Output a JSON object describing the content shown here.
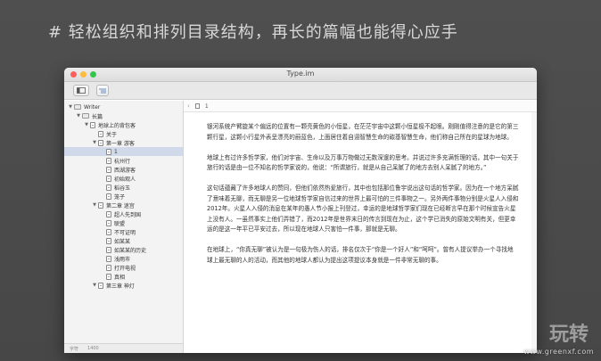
{
  "headline": "# 轻松组织和排列目录结构，再长的篇幅也能得心应手",
  "window": {
    "title": "Type.im"
  },
  "editor": {
    "tab_label": "1",
    "paragraphs": [
      "银河系统产臂旋某个偏远的位置有一颗亮黄色的小恒星，在茫茫宇宙中这颗小恒星极不起眼。刚刚值得注意的是它的第三颗行星，这颗小行星外表呈漂亮的蔚蓝色，上面居住着自诩智慧生命的碳基智慧生命，他们称自己所在的星球为地球。",
      "地球上有过许多哲学家，他们对宇宙、生命以及万事万物做过无数深邃的思考。并说过许多充满哲理的话，其中一句关于旅行的话是由一位不知名的哲学家说的，他说：“所谓旅行，就是从自己呆腻了的地方去别人呆腻了的地方。”",
      "这句话蕴藏了许多地球人的赞同，但他们依然热爱旅行，其中也包括那位鲁宇说出这句话的哲学家。因为在一个地方呆腻了意味着无聊，而无聊是另一位地球哲学家自信过来的世界上最可怕的三件事物之一。另外两件事物分别是火星人入侵和2012年。火星人入侵的消息在某年的愚人节小报上刊登过，幸运的是地球哲学家们现在已经断言早在那个时候宣告火星上没有人。一虽然事实上他们弄错了，而2012年是世界末日的传言到现在为止，这个学已消失的原始文明有关，但更幸运的是这一年平已平安过去，所以现在地球人只害怕一件事，那就是无聊。",
      "在地球上，“你真无聊”被认为是一句极为伤人的话，排名仅次于“你是一个好人”和“呵呵”。曾有人提议举办一个寻找地球上最无聊的人的活动，而其他的地球人都认为提出这项提议本身就是一件非常无聊的事。"
    ]
  },
  "sidebar": {
    "items": [
      {
        "label": "Writer",
        "level": 0,
        "type": "folder",
        "expanded": true
      },
      {
        "label": "长篇",
        "level": 1,
        "type": "folder",
        "expanded": true
      },
      {
        "label": "地球上的背包客",
        "level": 2,
        "type": "doc",
        "expanded": true
      },
      {
        "label": "关于",
        "level": 3,
        "type": "doc"
      },
      {
        "label": "第一章  游客",
        "level": 3,
        "type": "doc",
        "expanded": true
      },
      {
        "label": "1",
        "level": 4,
        "type": "doc",
        "selected": true
      },
      {
        "label": "杭州行",
        "level": 4,
        "type": "doc"
      },
      {
        "label": "西湖游客",
        "level": 4,
        "type": "doc"
      },
      {
        "label": "初始观人",
        "level": 4,
        "type": "doc"
      },
      {
        "label": "稻谷玉",
        "level": 4,
        "type": "doc"
      },
      {
        "label": "笼子",
        "level": 4,
        "type": "doc"
      },
      {
        "label": "第二章  迷宫",
        "level": 3,
        "type": "doc",
        "expanded": true
      },
      {
        "label": "超人先到国",
        "level": 4,
        "type": "doc"
      },
      {
        "label": "联盟",
        "level": 4,
        "type": "doc"
      },
      {
        "label": "不可证明",
        "level": 4,
        "type": "doc"
      },
      {
        "label": "如某某",
        "level": 4,
        "type": "doc"
      },
      {
        "label": "如某某的历史",
        "level": 4,
        "type": "doc"
      },
      {
        "label": "浅雨市",
        "level": 4,
        "type": "doc"
      },
      {
        "label": "打开电视",
        "level": 4,
        "type": "doc"
      },
      {
        "label": "真相",
        "level": 4,
        "type": "doc"
      },
      {
        "label": "第三章  神灯",
        "level": 3,
        "type": "doc",
        "expanded": true
      }
    ],
    "footer": [
      "字符",
      "1400"
    ]
  },
  "watermark": {
    "big": "玩转",
    "small": "www.greenxf.com"
  },
  "icons": {
    "sidebar_toggle": "sidebar-toggle-icon",
    "outline": "outline-icon",
    "back": "back-arrow-icon"
  }
}
